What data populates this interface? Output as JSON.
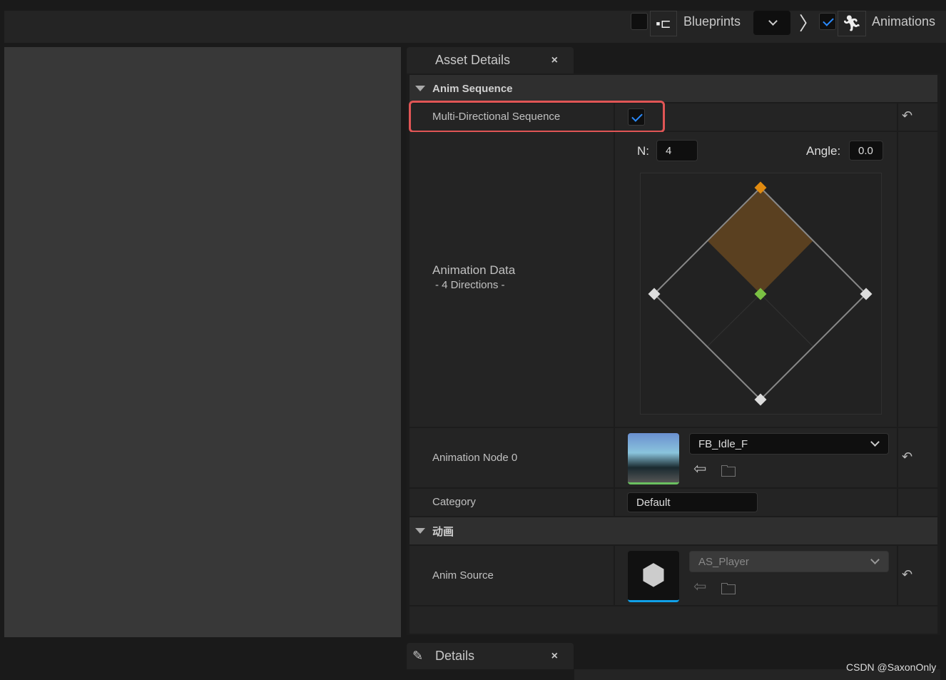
{
  "toolbar": {
    "blueprints_label": "Blueprints",
    "blueprints_checked": false,
    "animations_label": "Animations",
    "animations_checked": true
  },
  "asset_details": {
    "tab_label": "Asset Details",
    "close": "×",
    "section_anim_sequence": "Anim Sequence",
    "multi_directional_label": "Multi-Directional Sequence",
    "multi_directional_checked": true,
    "n_label": "N:",
    "n_value": "4",
    "angle_label": "Angle:",
    "angle_value": "0.0",
    "animation_data_label": "Animation Data",
    "animation_data_sub": "- 4 Directions -",
    "directions": 4,
    "selected_direction": "up",
    "animation_node_label": "Animation Node 0",
    "animation_node_value": "FB_Idle_F",
    "category_label": "Category",
    "category_value": "Default",
    "section_animation": "动画",
    "anim_source_label": "Anim Source",
    "anim_source_value": "AS_Player"
  },
  "details_tab": {
    "label": "Details",
    "close": "×"
  },
  "watermark": "CSDN @SaxonOnly",
  "colors": {
    "highlight": "#e05555",
    "accent": "#2a8bff",
    "selected_quadrant": "#5a4020",
    "selected_point": "#e08a10",
    "center_point": "#7ac043"
  }
}
